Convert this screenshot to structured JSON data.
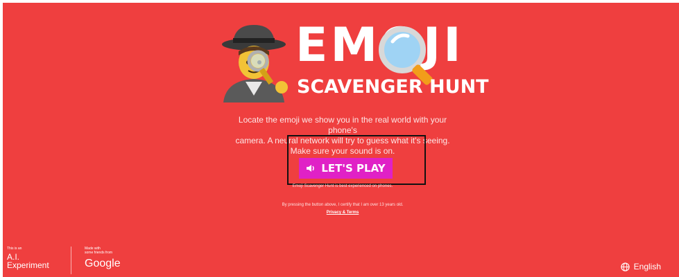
{
  "logo": {
    "title_line1": "EMOJI",
    "title_line2": "SCAVENGER HUNT"
  },
  "description": {
    "line1": "Locate the emoji we show you in the real world with your phone's",
    "line2": "camera. A neural network will try to guess what it's seeing.",
    "line3": "Make sure your sound is on."
  },
  "play_button": {
    "label": "LET'S PLAY",
    "icon": "speaker-icon"
  },
  "notes": {
    "best_on_phones": "Emoji Scavenger Hunt is best experienced on phones.",
    "certify": "By pressing the button above, I certify that I am over 13 years old.",
    "privacy_link": "Privacy & Terms"
  },
  "footer": {
    "ai_small": "This is an",
    "ai_line1": "A.I.",
    "ai_line2": "Experiment",
    "google_small1": "Made with",
    "google_small2": "some friends from",
    "google_brand": "Google",
    "language": "English",
    "language_icon": "globe-icon"
  },
  "colors": {
    "background": "#ef3f3f",
    "button": "#e021c6"
  }
}
